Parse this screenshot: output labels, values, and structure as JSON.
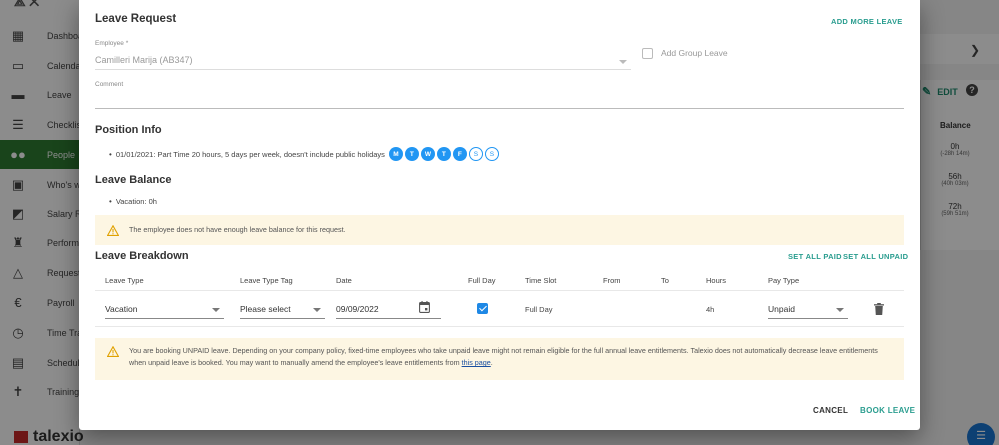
{
  "background": {
    "sidebar": [
      {
        "label": "Dashboard",
        "icon": "dashboard-icon",
        "glyph": "▦"
      },
      {
        "label": "Calendar",
        "icon": "calendar-icon",
        "glyph": "▭"
      },
      {
        "label": "Leave",
        "icon": "leave-icon",
        "glyph": "▬"
      },
      {
        "label": "Checklists",
        "icon": "checklist-icon",
        "glyph": "☰"
      },
      {
        "label": "People",
        "icon": "people-icon",
        "glyph": "●●"
      },
      {
        "label": "Who's who",
        "icon": "badge-icon",
        "glyph": "▣"
      },
      {
        "label": "Salary Reviews",
        "icon": "chart-icon",
        "glyph": "◩"
      },
      {
        "label": "Performance",
        "icon": "run-icon",
        "glyph": "♜"
      },
      {
        "label": "Requests",
        "icon": "warning-icon",
        "glyph": "△"
      },
      {
        "label": "Payroll",
        "icon": "euro-icon",
        "glyph": "€"
      },
      {
        "label": "Time Tracking",
        "icon": "clock-icon",
        "glyph": "◷"
      },
      {
        "label": "Schedules",
        "icon": "schedule-icon",
        "glyph": "▤"
      },
      {
        "label": "Training",
        "icon": "training-icon",
        "glyph": "✝"
      }
    ],
    "brand": "talexio",
    "edit_label": "EDIT",
    "help_glyph": "?",
    "balance_header": "Balance",
    "balance_rows": [
      {
        "value": "0h",
        "sub": "(-28h 14m)"
      },
      {
        "value": "56h",
        "sub": "(40h 03m)"
      },
      {
        "value": "72h",
        "sub": "(59h 51m)"
      }
    ]
  },
  "modal": {
    "title": "Leave Request",
    "add_more_leave": "ADD MORE LEAVE",
    "employee_label": "Employee *",
    "employee_value": "Camilleri Marija (AB347)",
    "add_group_leave": "Add Group Leave",
    "comment_label": "Comment",
    "position_info_title": "Position Info",
    "position_line": "01/01/2021: Part Time 20 hours, 5 days per week, doesn't include public holidays",
    "days": [
      {
        "letter": "M",
        "on": true
      },
      {
        "letter": "T",
        "on": true
      },
      {
        "letter": "W",
        "on": true
      },
      {
        "letter": "T",
        "on": true
      },
      {
        "letter": "F",
        "on": true
      },
      {
        "letter": "S",
        "on": false
      },
      {
        "letter": "S",
        "on": false
      }
    ],
    "leave_balance_title": "Leave Balance",
    "balance_line": "Vacation: 0h",
    "balance_warning": "The employee does not have enough leave balance for this request.",
    "breakdown_title": "Leave Breakdown",
    "set_all_paid": "SET ALL PAID",
    "set_all_unpaid": "SET ALL UNPAID",
    "columns": [
      "Leave Type",
      "Leave Type Tag",
      "Date",
      "Full Day",
      "Time Slot",
      "From",
      "To",
      "Hours",
      "Pay Type"
    ],
    "row": {
      "leave_type": "Vacation",
      "leave_type_tag": "Please select",
      "date": "09/09/2022",
      "full_day": true,
      "time_slot": "Full Day",
      "hours": "4h",
      "pay_type": "Unpaid"
    },
    "unpaid_warning": "You are booking UNPAID leave. Depending on your company policy, fixed-time employees who take unpaid leave might not remain eligible for the full annual leave entitlements. Talexio does not automatically decrease leave entitlements when unpaid leave is booked. You may want to manually amend the employee's leave entitlements from",
    "unpaid_link": "this page",
    "unpaid_end": ".",
    "cancel": "CANCEL",
    "book_leave": "BOOK LEAVE",
    "colors": {
      "accent": "#2a9d8f",
      "day_blue": "#2196f3",
      "warning_bg": "#fdf6e3",
      "warning_icon": "#f0a500"
    }
  }
}
